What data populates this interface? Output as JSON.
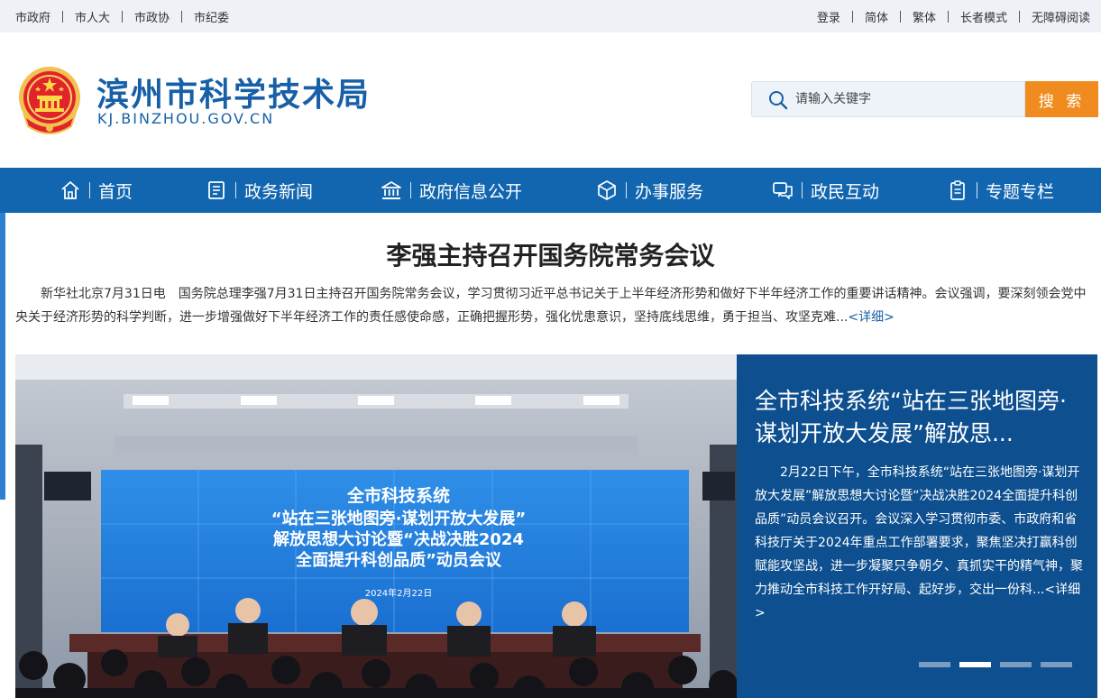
{
  "topbar": {
    "left_links": [
      "市政府",
      "市人大",
      "市政协",
      "市纪委"
    ],
    "right_links": [
      "登录",
      "简体",
      "繁体",
      "长者模式",
      "无障碍阅读"
    ]
  },
  "header": {
    "title": "滨州市科学技术局",
    "domain": "KJ.BINZHOU.GOV.CN",
    "emblem_icon": "national-emblem-icon"
  },
  "search": {
    "placeholder": "请输入关键字",
    "button_label": "搜 索",
    "button_color": "#f08c1f"
  },
  "nav": {
    "color": "#1266b0",
    "items": [
      {
        "label": "首页",
        "icon": "home-icon"
      },
      {
        "label": "政务新闻",
        "icon": "news-icon"
      },
      {
        "label": "政府信息公开",
        "icon": "government-building-icon"
      },
      {
        "label": "办事服务",
        "icon": "service-cube-icon"
      },
      {
        "label": "政民互动",
        "icon": "chat-icon"
      },
      {
        "label": "专题专栏",
        "icon": "clipboard-icon"
      }
    ]
  },
  "headline": {
    "title": "李强主持召开国务院常务会议",
    "summary": "新华社北京7月31日电　国务院总理李强7月31日主持召开国务院常务会议，学习贯彻习近平总书记关于上半年经济形势和做好下半年经济工作的重要讲话精神。会议强调，要深刻领会党中央关于经济形势的科学判断，进一步增强做好下半年经济工作的责任感使命感，正确把握形势，强化忧患意识，坚持底线思维，勇于担当、攻坚克难...",
    "more_label": "<详细>"
  },
  "slider": {
    "title": "全市科技系统“站在三张地图旁·谋划开放大发展”解放思...",
    "text": "2月22日下午，全市科技系统“站在三张地图旁·谋划开放大发展”解放思想大讨论暨“决战决胜2024全面提升科创品质”动员会议召开。会议深入学习贯彻市委、市政府和省科技厅关于2024年重点工作部署要求，聚焦坚决打赢科创赋能攻坚战，进一步凝聚只争朝夕、真抓实干的精气神，聚力推动全市科技工作开好局、起好步，交出一份科...",
    "more_label": "<详细>",
    "dots": 4,
    "active_dot": 1,
    "screen_lines": [
      "全市科技系统",
      "“站在三张地图旁·谋划开放大发展”",
      "解放思想大讨论暨“决战决胜2024",
      "全面提升科创品质”动员会议"
    ],
    "screen_date": "2024年2月22日"
  }
}
